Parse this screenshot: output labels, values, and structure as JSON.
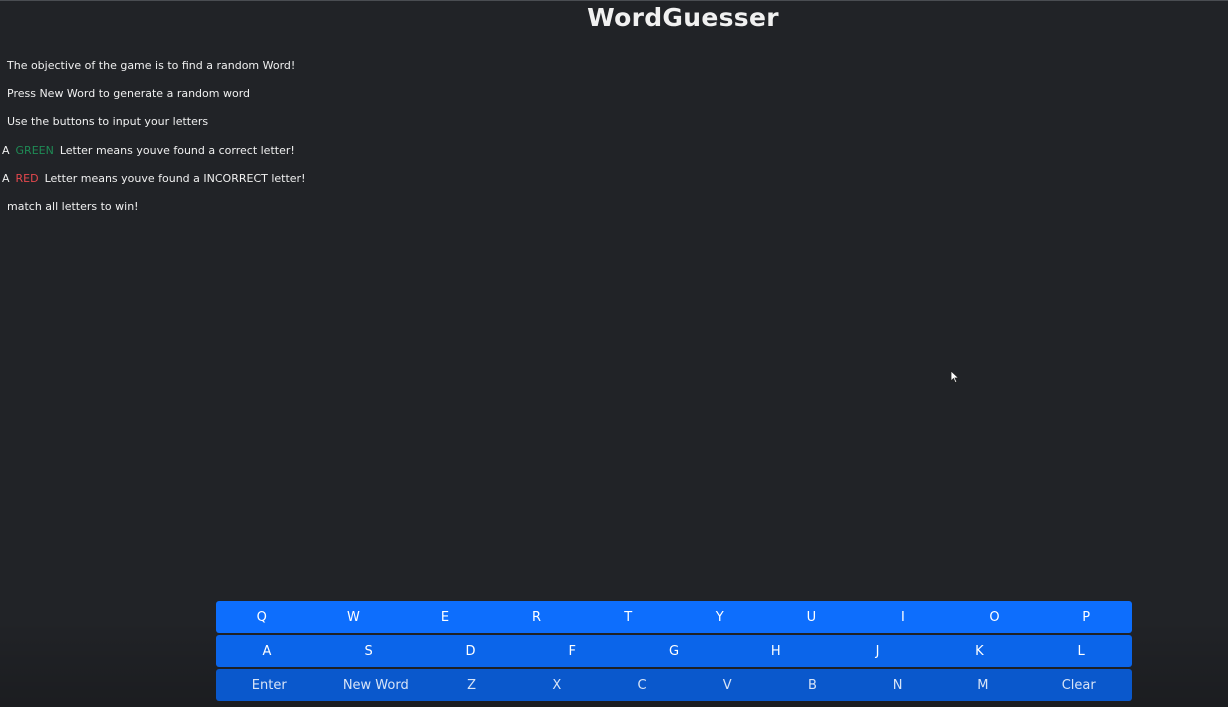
{
  "app": {
    "title": "WordGuesser"
  },
  "instructions": {
    "line1": "The objective of the game is to find a random Word!",
    "line2": "Press New Word to generate a random word",
    "line3": "Use the buttons to input your letters",
    "line4_prefix": "A",
    "line4_color_word": "GREEN",
    "line4_suffix": "Letter means youve found a correct letter!",
    "line5_prefix": "A",
    "line5_color_word": "RED",
    "line5_suffix": "Letter means youve found a INCORRECT letter!",
    "line6": "match all letters to win!"
  },
  "colors": {
    "background": "#212327",
    "correct": "#1f8a55",
    "incorrect": "#e5484d",
    "key_primary": "#0d6efd"
  },
  "keyboard": {
    "row1": [
      "Q",
      "W",
      "E",
      "R",
      "T",
      "Y",
      "U",
      "I",
      "O",
      "P"
    ],
    "row2": [
      "A",
      "S",
      "D",
      "F",
      "G",
      "H",
      "J",
      "K",
      "L"
    ],
    "row3": [
      "Enter",
      "New Word",
      "Z",
      "X",
      "C",
      "V",
      "B",
      "N",
      "M",
      "Clear"
    ]
  }
}
